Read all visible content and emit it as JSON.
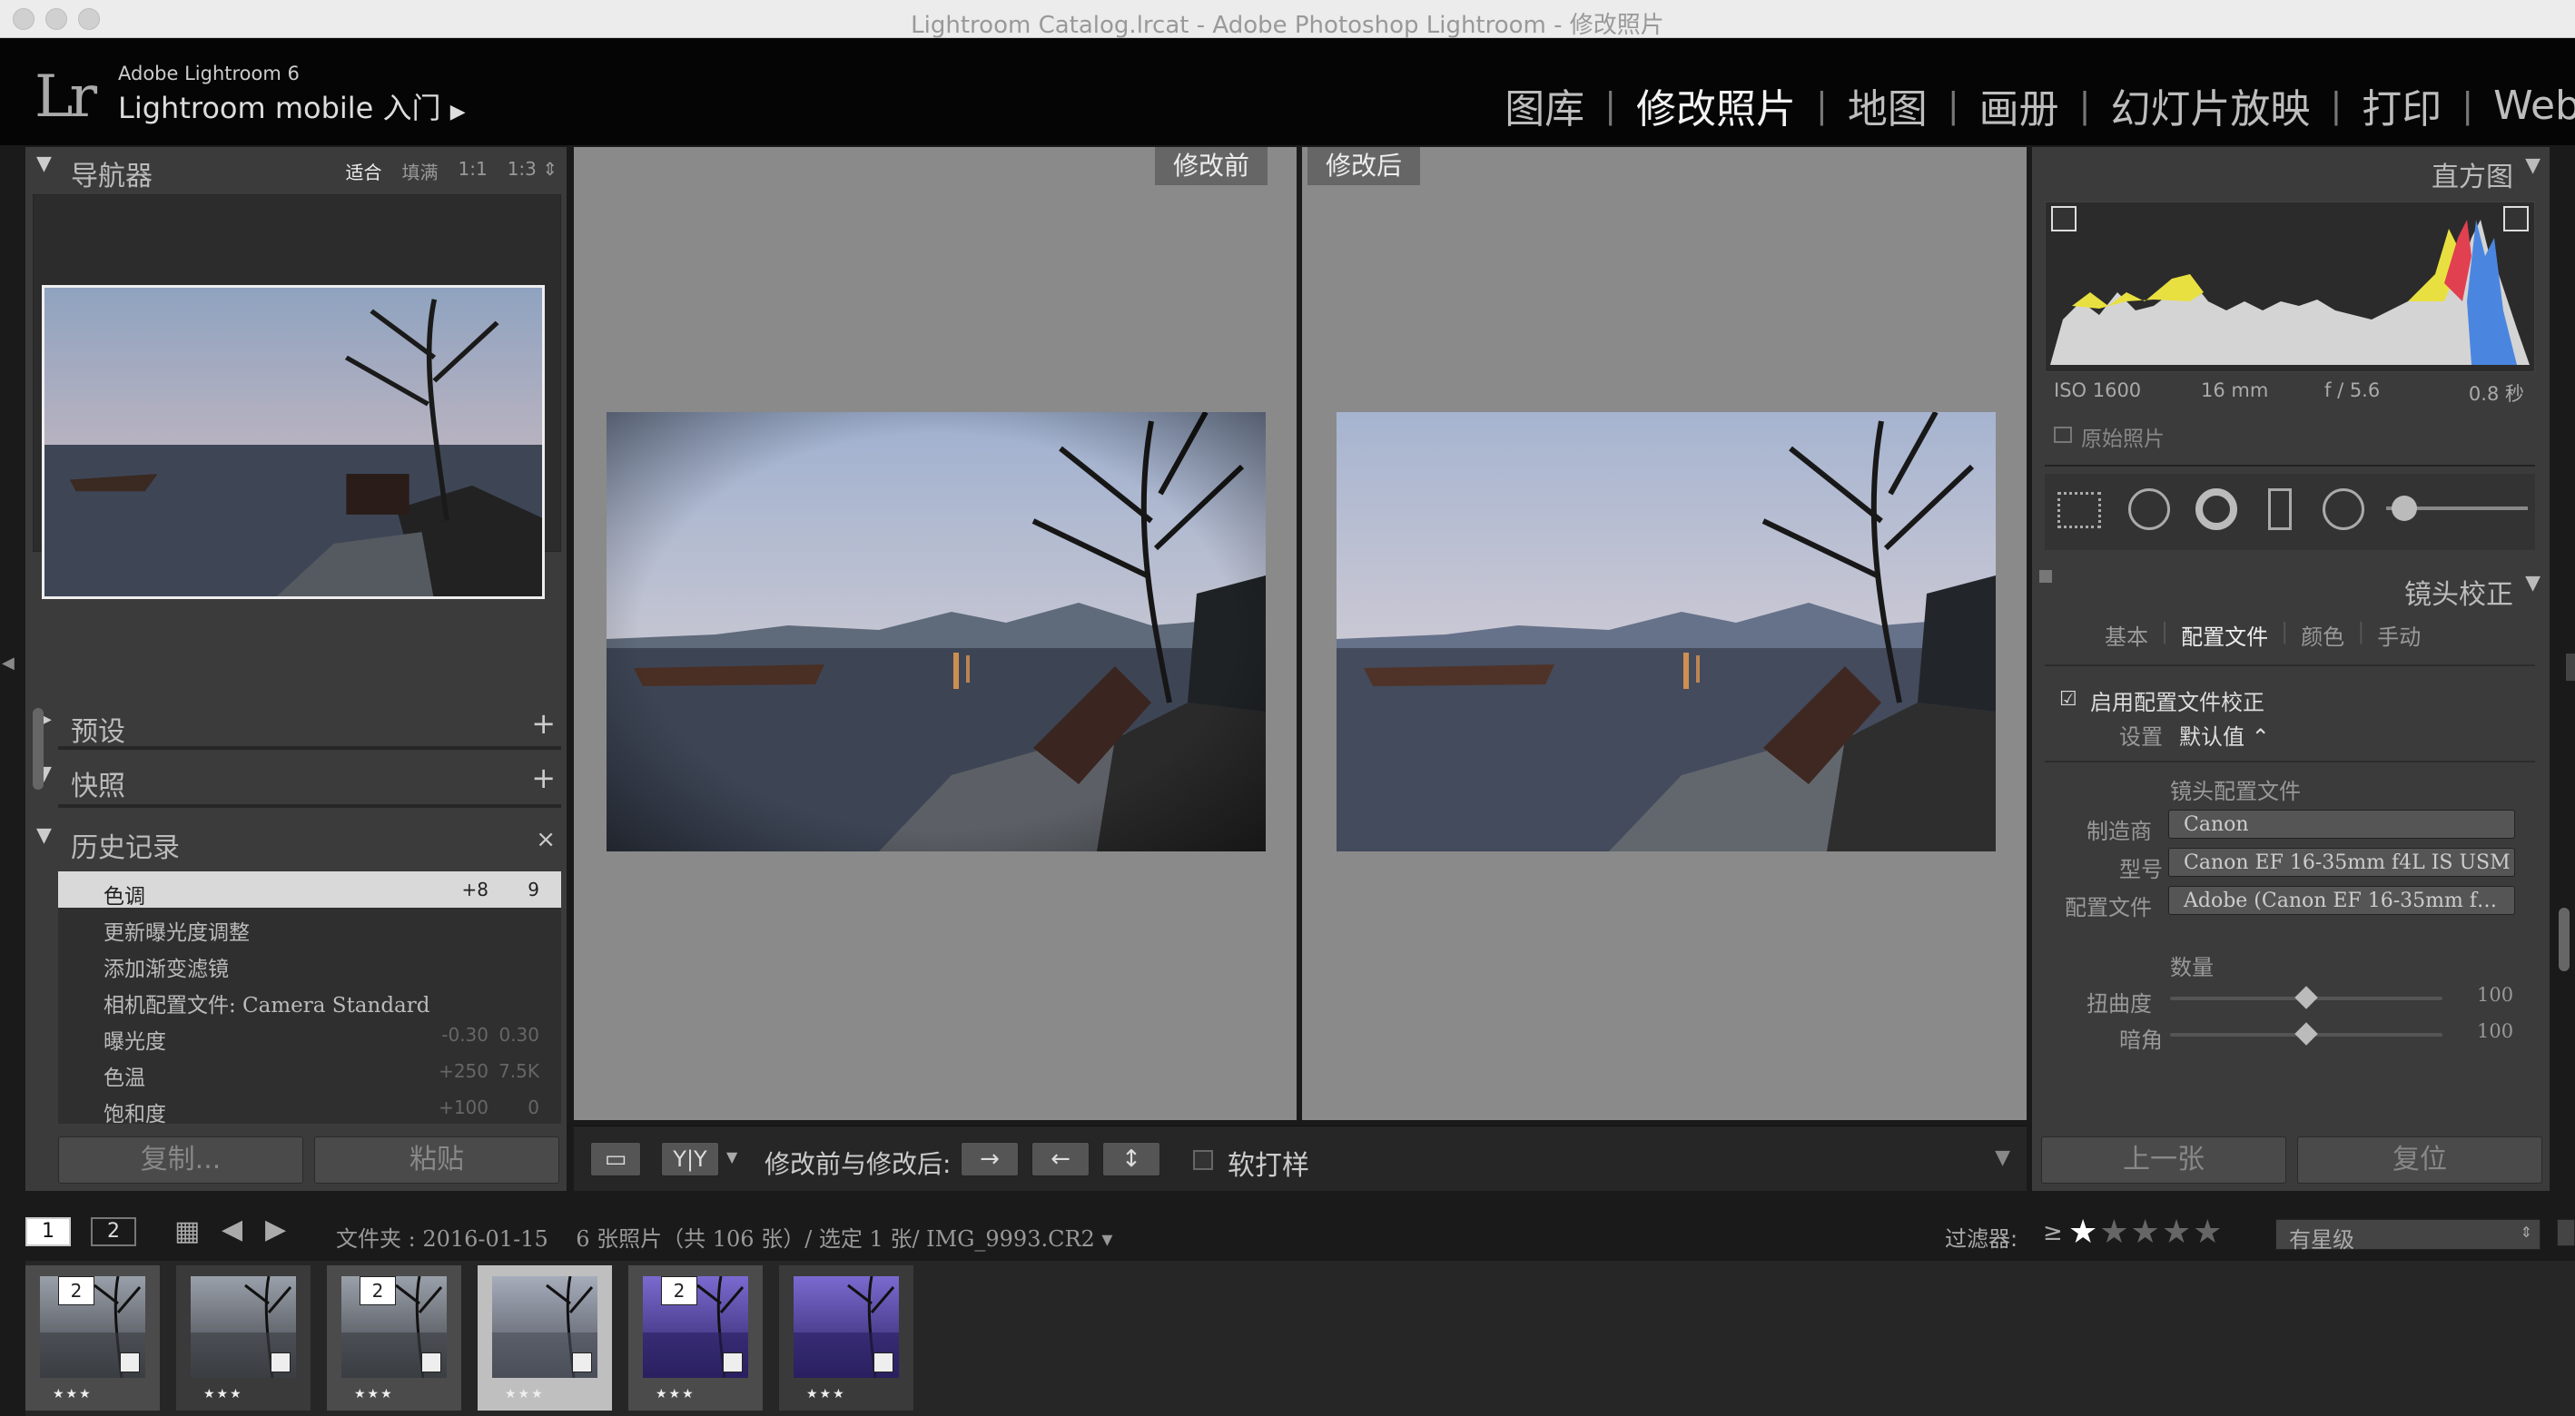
{
  "window": {
    "title": "Lightroom Catalog.lrcat - Adobe Photoshop Lightroom - 修改照片"
  },
  "identity": {
    "logo": "Lr",
    "product": "Adobe Lightroom 6",
    "subtitle": "Lightroom mobile 入门",
    "arrow": "▶"
  },
  "modules": [
    "图库",
    "修改照片",
    "地图",
    "画册",
    "幻灯片放映",
    "打印",
    "Web"
  ],
  "modules_active": "修改照片",
  "left": {
    "navigator": {
      "title": "导航器",
      "options": [
        "适合",
        "填满",
        "1:1",
        "1:3 ⇕"
      ]
    },
    "presets": {
      "title": "预设"
    },
    "snapshots": {
      "title": "快照"
    },
    "history": {
      "title": "历史记录",
      "close": "×",
      "items": [
        {
          "name": "色调",
          "a": "+8",
          "b": "9"
        },
        {
          "name": "更新曝光度调整",
          "a": "",
          "b": ""
        },
        {
          "name": "添加渐变滤镜",
          "a": "",
          "b": ""
        },
        {
          "name": "相机配置文件: Camera Standard",
          "a": "",
          "b": ""
        },
        {
          "name": "曝光度",
          "a": "-0.30",
          "b": "0.30"
        },
        {
          "name": "色温",
          "a": "+250",
          "b": "7.5K"
        },
        {
          "name": "饱和度",
          "a": "+100",
          "b": "0"
        }
      ]
    },
    "copy_btn": "复制...",
    "paste_btn": "粘贴"
  },
  "view": {
    "before_label": "修改前",
    "after_label": "修改后"
  },
  "toolbar": {
    "yy": "Y|Y",
    "before_after_label": "修改前与修改后:",
    "soft_proof": "软打样"
  },
  "right": {
    "histogram": {
      "title": "直方图",
      "iso": "ISO 1600",
      "focal": "16 mm",
      "aperture": "f / 5.6",
      "shutter": "0.8 秒",
      "original": "原始照片"
    },
    "lens": {
      "title": "镜头校正",
      "tabs": [
        "基本",
        "配置文件",
        "颜色",
        "手动"
      ],
      "active_tab": "配置文件",
      "enable": "启用配置文件校正",
      "setup_label": "设置",
      "setup_value": "默认值 ⌃",
      "profile_heading": "镜头配置文件",
      "make_label": "制造商",
      "make_value": "Canon",
      "model_label": "型号",
      "model_value": "Canon EF 16-35mm f4L IS USM",
      "profile_label": "配置文件",
      "profile_value": "Adobe (Canon EF 16-35mm f…",
      "amount_heading": "数量",
      "distortion_label": "扭曲度",
      "distortion_value": "100",
      "vignette_label": "暗角",
      "vignette_value": "100",
      "distortion_level": 0.5,
      "vignette_level": 0.5
    },
    "prev_btn": "上一张",
    "reset_btn": "复位"
  },
  "filmbar": {
    "tab1": "1",
    "tab2": "2",
    "path": "文件夹 : 2016-01-15    6 张照片（共 106 张）/ 选定 1 张/ IMG_9993.CR2 ▾",
    "filter_label": "过滤器:",
    "gte": "≥",
    "filter_select": "有星级"
  },
  "film": [
    {
      "badge": "2",
      "stars": "★★★",
      "tone": "gray"
    },
    {
      "badge": "",
      "stars": "★★★",
      "tone": "gray"
    },
    {
      "badge": "2",
      "stars": "★★★",
      "tone": "gray"
    },
    {
      "badge": "",
      "stars": "★★★",
      "tone": "selected"
    },
    {
      "badge": "2",
      "stars": "★★★",
      "tone": "purple"
    },
    {
      "badge": "",
      "stars": "★★★",
      "tone": "purple"
    }
  ],
  "colors": {
    "panel": "#3b3b3b",
    "view": "#8a8a8a",
    "accent": "#f2f2f2"
  }
}
